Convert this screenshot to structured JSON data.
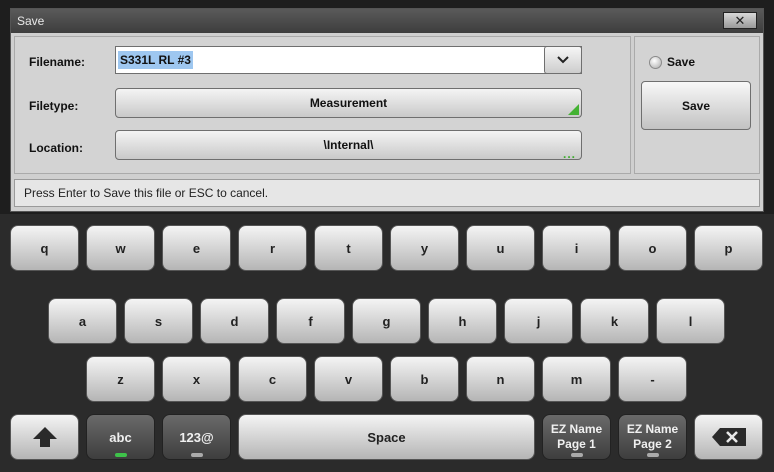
{
  "dialog": {
    "title": "Save",
    "close_label": "✕",
    "filename_label": "Filename:",
    "filename_value": "S331L RL #3",
    "filetype_label": "Filetype:",
    "filetype_value": "Measurement",
    "location_label": "Location:",
    "location_value": "\\Internal\\",
    "location_more": "...",
    "radio_label": "Save",
    "save_button": "Save",
    "status": "Press Enter to Save this file or ESC to cancel."
  },
  "keyboard": {
    "row1": [
      "q",
      "w",
      "e",
      "r",
      "t",
      "y",
      "u",
      "i",
      "o",
      "p"
    ],
    "row2": [
      "a",
      "s",
      "d",
      "f",
      "g",
      "h",
      "j",
      "k",
      "l"
    ],
    "row3": [
      "z",
      "x",
      "c",
      "v",
      "b",
      "n",
      "m",
      "-"
    ],
    "abc": "abc",
    "num": "123@",
    "space": "Space",
    "ez1_line1": "EZ Name",
    "ez1_line2": "Page 1",
    "ez2_line1": "EZ Name",
    "ez2_line2": "Page 2"
  },
  "colors": {
    "indicator_green": "#3ec24a",
    "selection_blue": "#9ec7f0"
  }
}
